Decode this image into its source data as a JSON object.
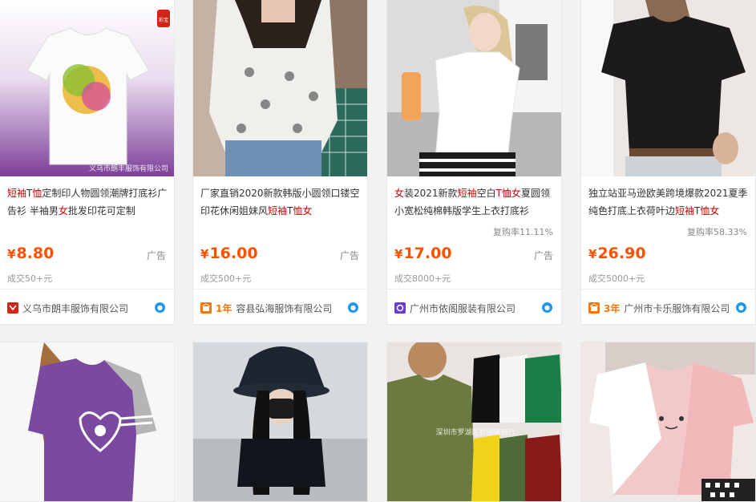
{
  "products": [
    {
      "title_parts": [
        {
          "text": "短袖",
          "hl": true
        },
        {
          "text": "T",
          "hl": false
        },
        {
          "text": "恤",
          "hl": true
        },
        {
          "text": "定制印人物圆领潮牌打底衫广告衫 半袖男",
          "hl": false
        },
        {
          "text": "女",
          "hl": true
        },
        {
          "text": "批发印花可定制",
          "hl": false
        }
      ],
      "image_watermark": "义乌市朗丰服饰有限公司",
      "badge_text": "彩宝",
      "rebuy": "",
      "currency": "¥",
      "price": "8.80",
      "ad_label": "广告",
      "volume": "成交50+元",
      "shop_badge_color": "#d0261a",
      "years": "",
      "shop_name": "义乌市朗丰服饰有限公司"
    },
    {
      "title_parts": [
        {
          "text": "厂家直销2020新款韩版小圆领口镂空印花休闲姐妹风",
          "hl": false
        },
        {
          "text": "短袖",
          "hl": true
        },
        {
          "text": "T",
          "hl": false
        },
        {
          "text": "恤",
          "hl": true
        },
        {
          "text": "女",
          "hl": true
        }
      ],
      "rebuy": "",
      "currency": "¥",
      "price": "16.00",
      "ad_label": "广告",
      "volume": "成交500+元",
      "shop_badge_color": "#ff7300",
      "years": "1年",
      "shop_name": "容县弘海服饰有限公司"
    },
    {
      "title_parts": [
        {
          "text": "女",
          "hl": true
        },
        {
          "text": "装2021新款",
          "hl": false
        },
        {
          "text": "短袖",
          "hl": true
        },
        {
          "text": "空白",
          "hl": false
        },
        {
          "text": "T恤女",
          "hl": true
        },
        {
          "text": "夏圆领小宽松纯棉韩版学生上衣打底衫",
          "hl": false
        }
      ],
      "rebuy": "复购率11.11%",
      "currency": "¥",
      "price": "17.00",
      "ad_label": "广告",
      "volume": "成交8000+元",
      "shop_badge_color": "#6a3bd1",
      "years": "",
      "shop_name": "广州市依阁服装有限公司"
    },
    {
      "title_parts": [
        {
          "text": "独立站亚马逊欧美跨境爆款2021夏季纯色打底上衣荷叶边",
          "hl": false
        },
        {
          "text": "短袖",
          "hl": true
        },
        {
          "text": "T",
          "hl": false
        },
        {
          "text": "恤女",
          "hl": true
        }
      ],
      "rebuy": "复购率58.33%",
      "currency": "¥",
      "price": "26.90",
      "ad_label": "",
      "volume": "成交5000+元",
      "shop_badge_color": "#ff7300",
      "years": "3年",
      "shop_name": "广州市卡乐服饰有限公司"
    }
  ],
  "row2_watermark": "深圳市罗湖区衣服装商行",
  "colors": {
    "price": "#ff5000",
    "highlight": "#cc0000",
    "accent": "#ff5000",
    "wangwang": "#1e96f0"
  },
  "icons": {
    "shop_badge": "shop-badge-icon",
    "wangwang": "wangwang-chat-icon"
  }
}
